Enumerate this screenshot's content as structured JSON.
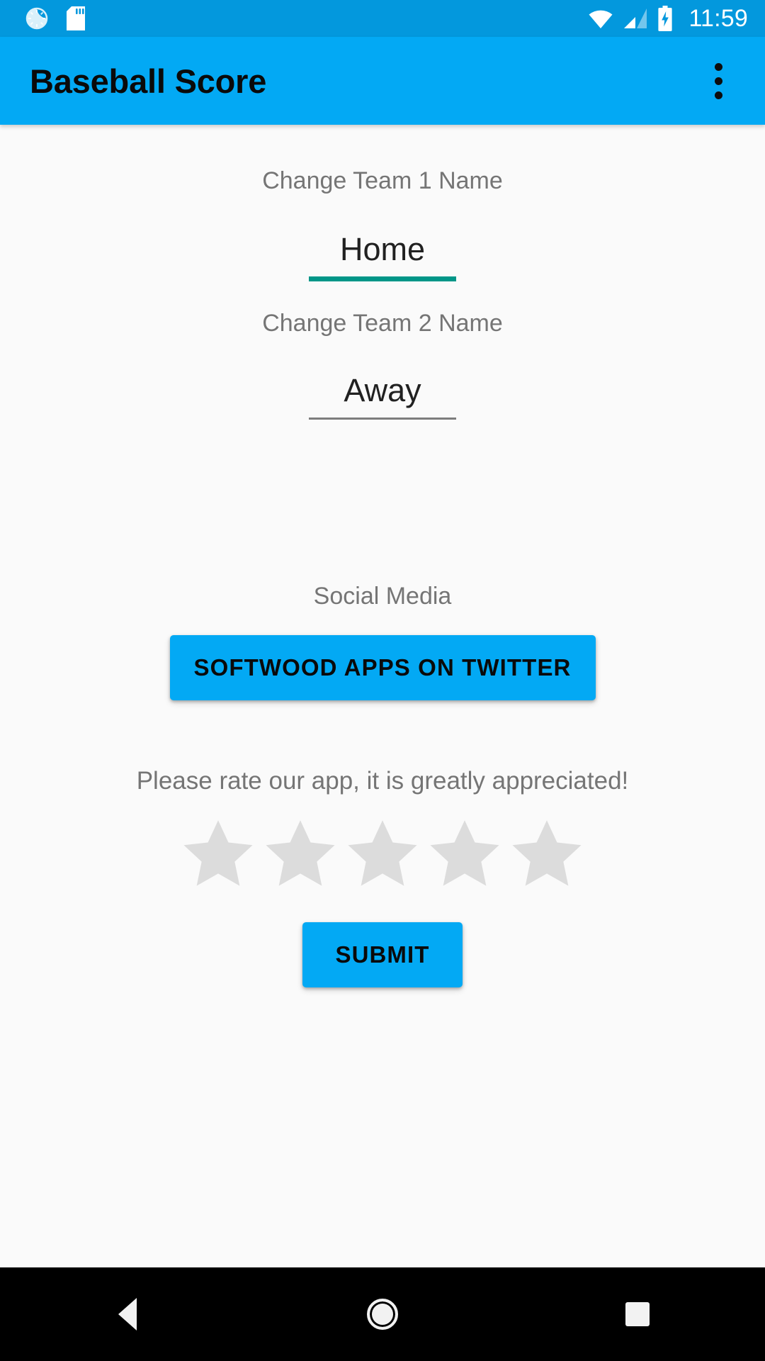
{
  "status_bar": {
    "background_color": "#0398dd",
    "time": "11:59",
    "icons_left": [
      "dnd-icon",
      "sdcard-icon"
    ],
    "icons_right": [
      "wifi-icon",
      "cellular-signal-icon",
      "battery-charging-icon"
    ],
    "wifi_level": "full",
    "signal_bars": 2,
    "battery_state": "charging"
  },
  "app_bar": {
    "title": "Baseball Score",
    "background_color": "#03a9f4",
    "title_color": "#0a0a0a",
    "overflow_icon": "more-vertical-icon"
  },
  "form": {
    "team1": {
      "label": "Change Team 1 Name",
      "value": "Home",
      "placeholder": "Team 1",
      "focused": true,
      "underline_color": "#009688"
    },
    "team2": {
      "label": "Change Team 2 Name",
      "value": "Away",
      "placeholder": "Team 2",
      "focused": false,
      "underline_color": "#7d7d7d"
    }
  },
  "social": {
    "label": "Social Media",
    "twitter_button_label": "SOFTWOOD APPS ON TWITTER",
    "button_color": "#03a9f4"
  },
  "rating": {
    "prompt": "Please rate our app, it is greatly appreciated!",
    "stars_total": 5,
    "stars_filled": 0,
    "star_empty_color": "#dcdcdc",
    "submit_label": "SUBMIT"
  },
  "nav_bar": {
    "background_color": "#000000",
    "buttons": [
      "back-icon",
      "home-icon",
      "recents-icon"
    ]
  }
}
